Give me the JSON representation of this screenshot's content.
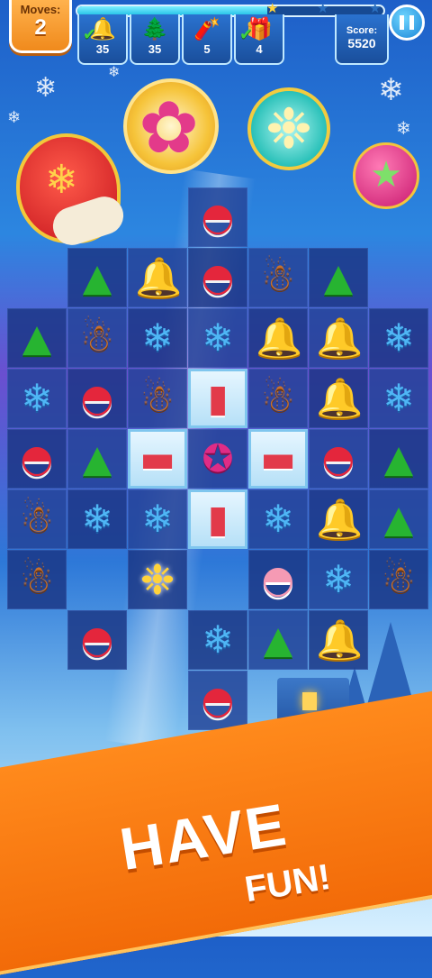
{
  "hud": {
    "moves_label": "Moves:",
    "moves_value": "2",
    "level_progress": 0.62,
    "score_label": "Score:",
    "score_value": "5520",
    "goals": [
      {
        "icon": "bell-icon",
        "glyph": "🔔",
        "count": "35",
        "completed": true
      },
      {
        "icon": "tree-icon",
        "glyph": "🌲",
        "count": "35",
        "completed": false
      },
      {
        "icon": "cracker-icon",
        "glyph": "🧨",
        "count": "5",
        "completed": false
      },
      {
        "icon": "gift-icon",
        "glyph": "🎁",
        "count": "4",
        "completed": true
      }
    ]
  },
  "boosters": [
    {
      "name": "mitten-booster",
      "glyph": "❄"
    },
    {
      "name": "color-star-booster",
      "glyph": "✿"
    },
    {
      "name": "snowflake-bomb-booster",
      "glyph": "❉"
    },
    {
      "name": "ornament-booster",
      "glyph": "★"
    }
  ],
  "pieces": {
    "tree": {
      "glyph": "▲",
      "cls": "p-tree",
      "icon": "tree-icon"
    },
    "hat": {
      "glyph": "◓",
      "cls": "p-hat",
      "icon": "santa-hat-icon"
    },
    "hatf": {
      "glyph": "◓",
      "cls": "p-hat-faded",
      "icon": "santa-hat-icon"
    },
    "bell": {
      "glyph": "🔔",
      "cls": "p-bell",
      "icon": "bell-icon"
    },
    "man": {
      "glyph": "☃",
      "cls": "p-man",
      "icon": "gingerbread-man-icon"
    },
    "flake": {
      "glyph": "❄",
      "cls": "p-flake",
      "icon": "snowflake-icon"
    },
    "crack": {
      "glyph": "▮",
      "cls": "p-cracker",
      "icon": "cracker-icon"
    },
    "crackh": {
      "glyph": "▬",
      "cls": "p-cracker",
      "icon": "cracker-icon"
    },
    "orn": {
      "glyph": "✪",
      "cls": "p-orn",
      "icon": "star-ornament-icon"
    },
    "bonus": {
      "glyph": "❉",
      "cls": "p-bonus",
      "icon": "snowflake-bomb-icon"
    }
  },
  "board": [
    [
      "",
      "",
      "",
      "hat",
      "",
      "",
      ""
    ],
    [
      "",
      "tree",
      "bell",
      "hat",
      "man",
      "tree",
      ""
    ],
    [
      "tree",
      "man",
      "flake",
      "flake",
      "bell",
      "bell",
      "flake"
    ],
    [
      "flake",
      "hat",
      "man",
      "crack",
      "man",
      "bell",
      "flake"
    ],
    [
      "hat",
      "tree",
      "crackh",
      "orn",
      "crackh",
      "hat",
      "tree"
    ],
    [
      "man",
      "flake",
      "flake",
      "crack",
      "flake",
      "bell",
      "tree"
    ],
    [
      "man",
      "",
      "bonus",
      "",
      "hatf",
      "flake",
      "man"
    ],
    [
      "",
      "hat",
      "",
      "flake",
      "tree",
      "bell",
      ""
    ],
    [
      "",
      "",
      "",
      "hat",
      "",
      "",
      ""
    ]
  ],
  "ice_cells": [
    [
      3,
      3
    ],
    [
      4,
      2
    ],
    [
      4,
      4
    ],
    [
      5,
      3
    ]
  ],
  "banner": {
    "line1": "HAVE",
    "line2": "FUN!"
  }
}
